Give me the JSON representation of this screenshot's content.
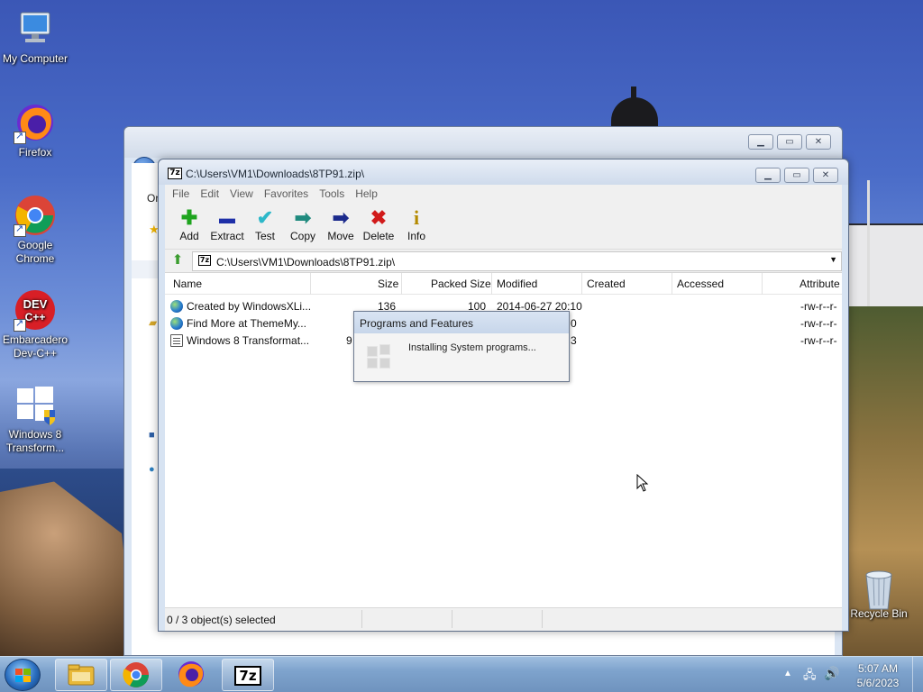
{
  "desktop": {
    "icons": [
      {
        "label": "My Computer"
      },
      {
        "label": "Firefox"
      },
      {
        "label": "Google Chrome"
      },
      {
        "label": "Embarcadero Dev-C++"
      },
      {
        "label": "Windows 8 Transform..."
      },
      {
        "label": "Recycle Bin"
      }
    ]
  },
  "background_window": {
    "partial_text_1": "Or"
  },
  "zip_window": {
    "title": "C:\\Users\\VM1\\Downloads\\8TP91.zip\\",
    "menu": [
      "File",
      "Edit",
      "View",
      "Favorites",
      "Tools",
      "Help"
    ],
    "toolbar": [
      {
        "label": "Add",
        "icon": "plus-icon",
        "glyph": "✚",
        "color": "#1ea41e"
      },
      {
        "label": "Extract",
        "icon": "minus-icon",
        "glyph": "▬",
        "color": "#1e2fa8"
      },
      {
        "label": "Test",
        "icon": "check-icon",
        "glyph": "✔",
        "color": "#2db8c9"
      },
      {
        "label": "Copy",
        "icon": "copy-arrow-icon",
        "glyph": "➡",
        "color": "#1f8a7e"
      },
      {
        "label": "Move",
        "icon": "move-arrow-icon",
        "glyph": "➡",
        "color": "#1b2a8c"
      },
      {
        "label": "Delete",
        "icon": "delete-x-icon",
        "glyph": "✖",
        "color": "#d11a1a"
      },
      {
        "label": "Info",
        "icon": "info-icon",
        "glyph": "i",
        "color": "#b48a00"
      }
    ],
    "address": "C:\\Users\\VM1\\Downloads\\8TP91.zip\\",
    "columns": [
      "Name",
      "Size",
      "Packed Size",
      "Modified",
      "Created",
      "Accessed",
      "Attribute"
    ],
    "rows": [
      {
        "name": "Created by WindowsXLi...",
        "size": "136",
        "packed": "100",
        "modified": "2014-06-27 20:10",
        "attr": "-rw-r--r-",
        "icon": "globe"
      },
      {
        "name": "Find More at ThemeMy...",
        "size": "",
        "packed": "",
        "modified": "0",
        "attr": "-rw-r--r-",
        "icon": "globe"
      },
      {
        "name": "Windows 8 Transformat...",
        "size": "9",
        "packed": "",
        "modified": "3",
        "attr": "-rw-r--r-",
        "icon": "doc"
      }
    ],
    "status": "0 / 3 object(s) selected"
  },
  "popup": {
    "title": "Programs and Features",
    "message": "Installing System programs..."
  },
  "taskbar": {
    "items": [
      "explorer",
      "chrome",
      "firefox",
      "7zip"
    ],
    "zip_label": "7z",
    "time": "5:07 AM",
    "date": "5/6/2023"
  }
}
